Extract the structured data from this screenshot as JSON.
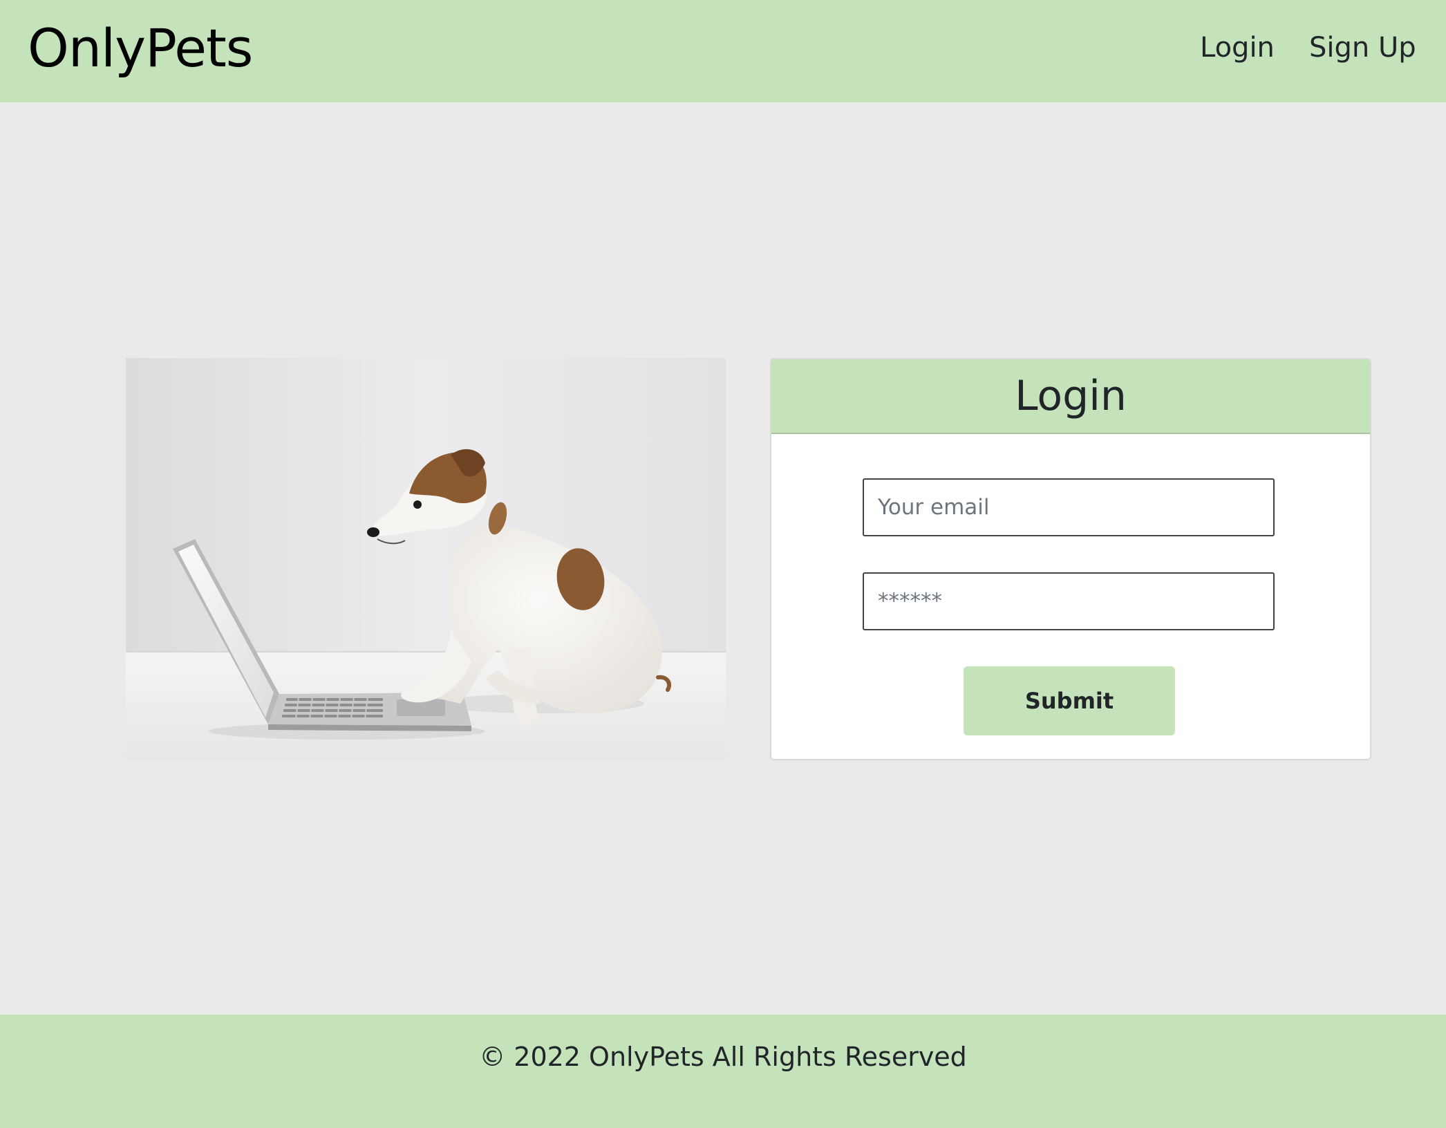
{
  "navbar": {
    "brand": "OnlyPets",
    "links": [
      {
        "label": "Login"
      },
      {
        "label": "Sign Up"
      }
    ]
  },
  "login_card": {
    "title": "Login",
    "email_placeholder": "Your email",
    "password_placeholder": "******",
    "submit_label": "Submit"
  },
  "footer": {
    "text": "© 2022 OnlyPets All Rights Reserved"
  },
  "colors": {
    "accent": "#c5e3bb",
    "background": "#eaeaea"
  },
  "image": {
    "subject": "dog-with-laptop-photo"
  }
}
